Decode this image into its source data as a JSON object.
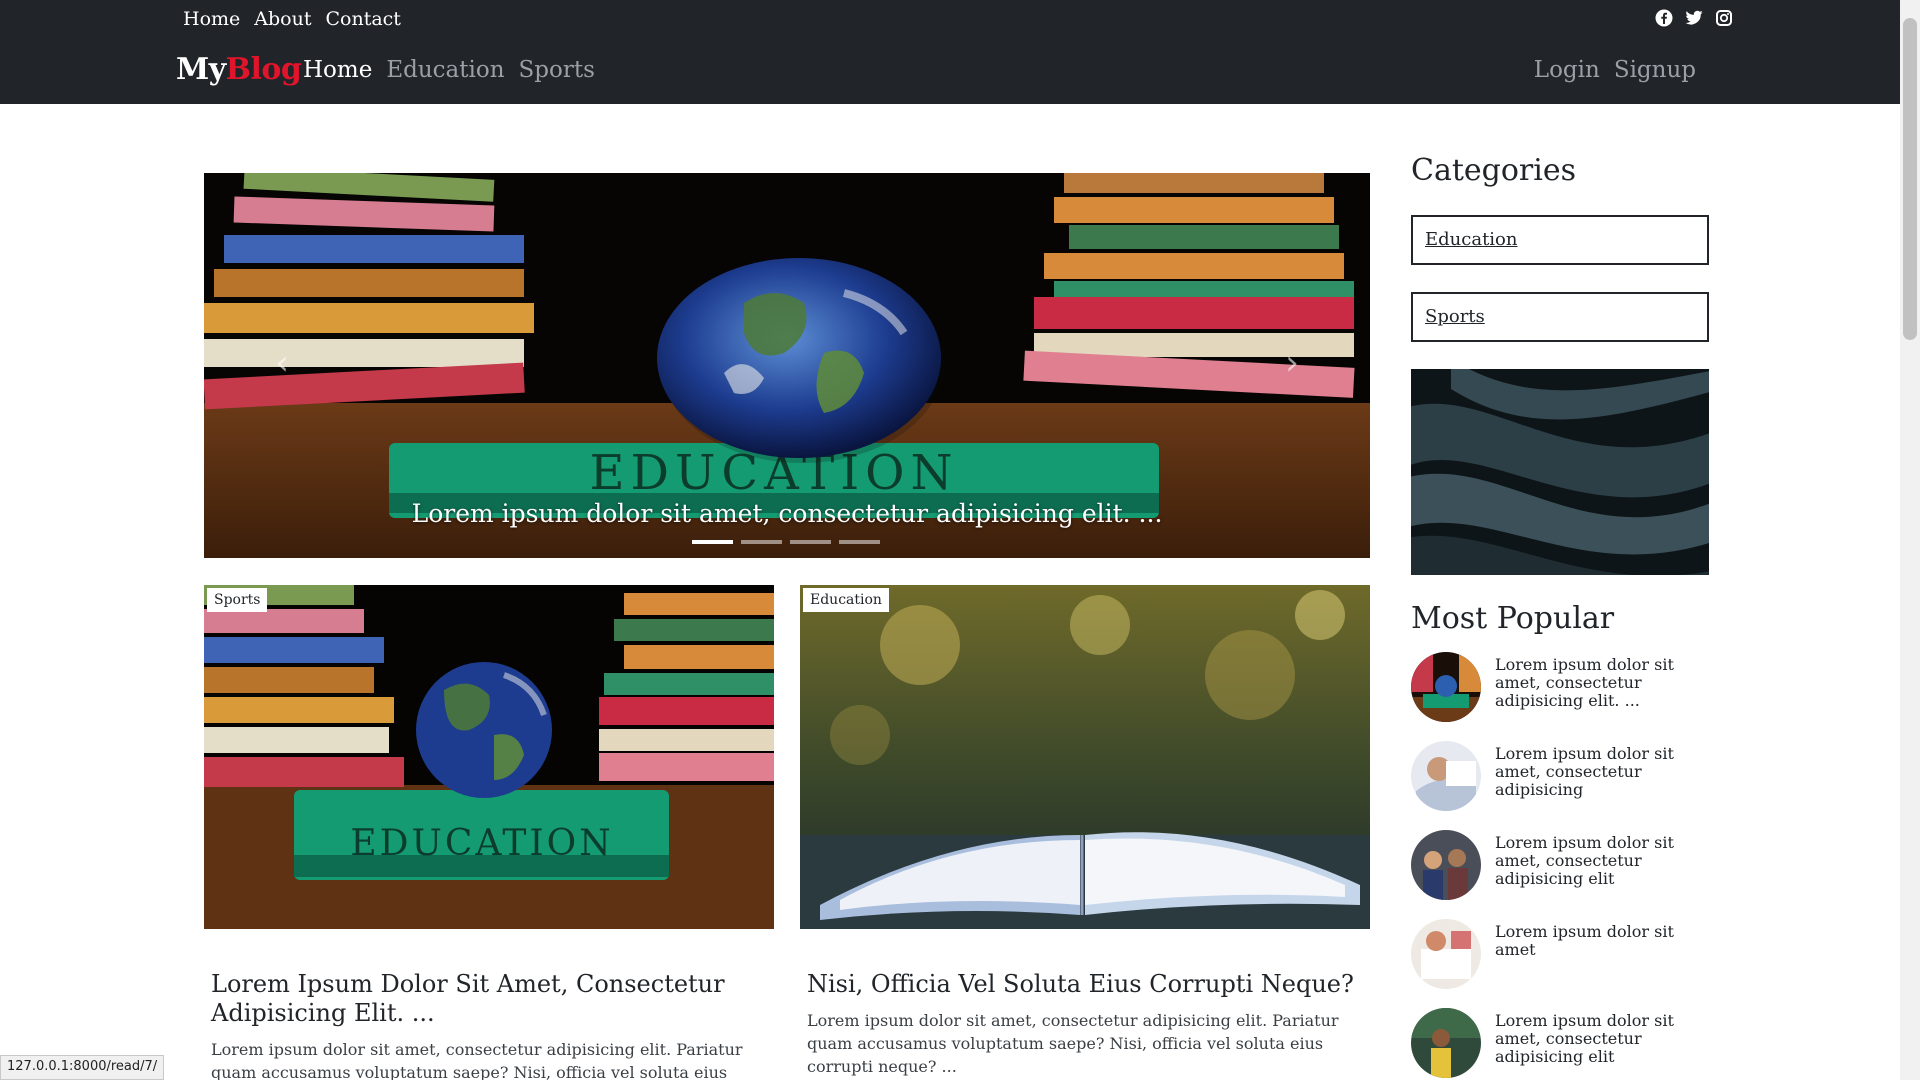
{
  "header": {
    "top_links": [
      "Home",
      "About",
      "Contact"
    ],
    "social_icons": [
      "facebook-icon",
      "twitter-icon",
      "instagram-icon"
    ],
    "brand_part1": "My",
    "brand_part2": "Blog",
    "brand_accent_color": "#e0142a",
    "nav_links": [
      "Home",
      "Education",
      "Sports"
    ],
    "active_nav": "Home",
    "auth_links": [
      "Login",
      "Signup"
    ]
  },
  "carousel": {
    "caption": "Lorem ipsum dolor sit amet, consectetur adipisicing elit. ...",
    "slide_count": 4,
    "active_slide": 1
  },
  "posts": [
    {
      "category": "Sports",
      "title": "Lorem Ipsum Dolor Sit Amet, Consectetur Adipisicing Elit. ...",
      "excerpt": "Lorem ipsum dolor sit amet, consectetur adipisicing elit. Pariatur quam accusamus voluptatum saepe? Nisi, officia vel soluta eius corrupti neque?"
    },
    {
      "category": "Education",
      "title": "Nisi, Officia Vel Soluta Eius Corrupti Neque?",
      "excerpt": "Lorem ipsum dolor sit amet, consectetur adipisicing elit. Pariatur quam accusamus voluptatum saepe? Nisi, officia vel soluta eius corrupti neque? ..."
    }
  ],
  "sidebar": {
    "categories_heading": "Categories",
    "categories": [
      "Education",
      "Sports"
    ],
    "popular_heading": "Most Popular",
    "popular": [
      "Lorem ipsum dolor sit amet, consectetur adipisicing elit. ...",
      "Lorem ipsum dolor sit amet, consectetur adipisicing",
      "Lorem ipsum dolor sit amet, consectetur adipisicing elit",
      "Lorem ipsum dolor sit amet",
      "Lorem ipsum dolor sit amet, consectetur adipisicing elit"
    ]
  },
  "status_url": "127.0.0.1:8000/read/7/"
}
